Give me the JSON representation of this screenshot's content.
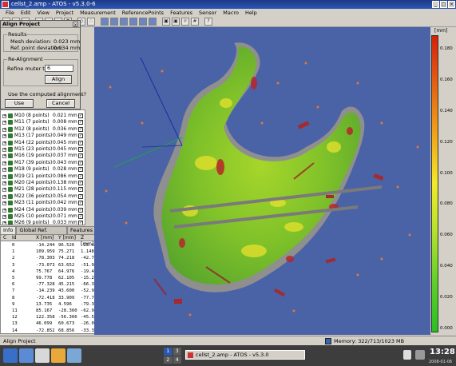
{
  "window": {
    "title": "cellst_2.amp - ATOS - v5.3.0-6"
  },
  "menu": [
    "File",
    "Edit",
    "View",
    "Project",
    "Measurement",
    "ReferencePoints",
    "Features",
    "Sensor",
    "Macro",
    "Help"
  ],
  "dialog": {
    "title": "Align Project",
    "close_label": "x",
    "results_group": "Results",
    "mesh_deviation_label": "Mesh deviation:",
    "mesh_deviation_value": "0.023 mm",
    "ref_deviation_label": "Ref. point deviation:",
    "ref_deviation_value": "0.034 mm",
    "realign_group": "Re-Alignment",
    "refine_label": "Refine muter to:",
    "refine_value": "6",
    "align_button": "Align",
    "question": "Use the computed alignment?",
    "use_button": "Use",
    "cancel_button": "Cancel"
  },
  "mesh_list": [
    {
      "name": "M10 (8 points)",
      "dev": "0.021 mm"
    },
    {
      "name": "M11 (7 points)",
      "dev": "0.008 mm"
    },
    {
      "name": "M12 (8 points)",
      "dev": "0.036 mm"
    },
    {
      "name": "M13 (17 points)",
      "dev": "0.049 mm"
    },
    {
      "name": "M14 (22 points)",
      "dev": "0.045 mm"
    },
    {
      "name": "M15 (23 points)",
      "dev": "0.045 mm"
    },
    {
      "name": "M16 (19 points)",
      "dev": "0.037 mm"
    },
    {
      "name": "M17 (39 points)",
      "dev": "0.043 mm"
    },
    {
      "name": "M18 (9 points)",
      "dev": "0.028 mm"
    },
    {
      "name": "M19 (21 points)",
      "dev": "0.086 mm"
    },
    {
      "name": "M20 (24 points)",
      "dev": "0.138 mm"
    },
    {
      "name": "M21 (28 points)",
      "dev": "0.115 mm"
    },
    {
      "name": "M22 (36 points)",
      "dev": "0.054 mm"
    },
    {
      "name": "M23 (11 points)",
      "dev": "0.042 mm"
    },
    {
      "name": "M24 (34 points)",
      "dev": "0.039 mm"
    },
    {
      "name": "M25 (10 points)",
      "dev": "0.071 mm"
    },
    {
      "name": "M26 (9 points)",
      "dev": "0.033 mm"
    }
  ],
  "tabs": [
    "Info",
    "Global Ref. Points",
    "Features"
  ],
  "ref_table": {
    "headers": [
      "C",
      "Id",
      "X [mm]",
      "Y [mm]",
      "Z [mm]"
    ],
    "rows": [
      [
        "",
        "0",
        "-14.244",
        "96.526",
        "-23.492"
      ],
      [
        "",
        "1",
        "109.959",
        "75.271",
        "1.148"
      ],
      [
        "",
        "2",
        "-78.303",
        "74.218",
        "-42.768"
      ],
      [
        "",
        "3",
        "-73.073",
        "63.652",
        "-51.932"
      ],
      [
        "",
        "4",
        "75.767",
        "64.976",
        "-19.412"
      ],
      [
        "",
        "5",
        "99.778",
        "62.105",
        "-15.284"
      ],
      [
        "",
        "6",
        "-77.328",
        "45.215",
        "-66.381"
      ],
      [
        "",
        "7",
        "-14.239",
        "43.600",
        "-52.945"
      ],
      [
        "",
        "8",
        "-72.418",
        "33.909",
        "-77.799"
      ],
      [
        "",
        "9",
        "13.735",
        "4.596",
        "-79.396"
      ],
      [
        "",
        "11",
        "85.167",
        "-28.360",
        "-62.986"
      ],
      [
        "",
        "12",
        "122.358",
        "-56.366",
        "-45.536"
      ],
      [
        "",
        "13",
        "46.099",
        "60.673",
        "-26.092"
      ],
      [
        "",
        "14",
        "-72.852",
        "68.856",
        "-33.316"
      ]
    ]
  },
  "scale": {
    "unit": "[mm]",
    "labels": [
      "0.180",
      "0.160",
      "0.140",
      "0.120",
      "0.100",
      "0.080",
      "0.060",
      "0.040",
      "0.020",
      "0.000"
    ]
  },
  "status": {
    "left": "Align Project",
    "memory": "Memory: 322/713/1023 MB"
  },
  "taskbar": {
    "pager": [
      "1",
      "3",
      "2",
      "4"
    ],
    "task_label": "cellst_2.amp - ATOS - v5.3.0",
    "clock": "13:28",
    "date": "2008-01-06"
  }
}
